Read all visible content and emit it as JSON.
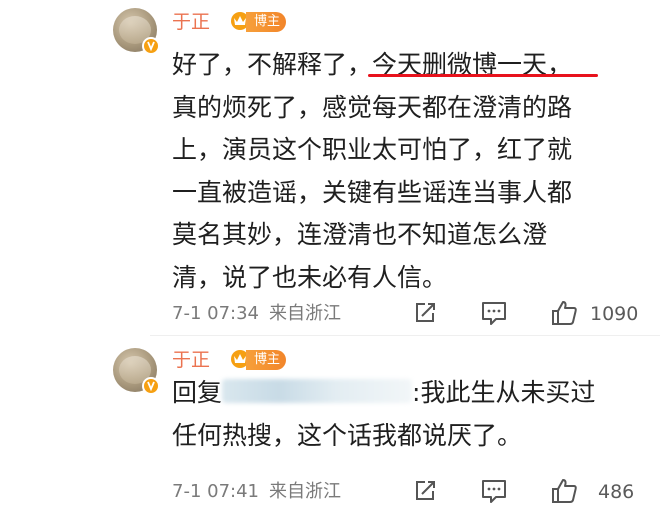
{
  "comments": [
    {
      "user": {
        "name": "于正",
        "tag": "博主"
      },
      "lines": [
        {
          "before": "好了，不解释了，",
          "underlined": "今天删微博一天，"
        },
        {
          "text": "真的烦死了，感觉每天都在澄清的路"
        },
        {
          "text": "上，演员这个职业太可怕了，红了就"
        },
        {
          "text": "一直被造谣，关键有些谣连当事人都"
        },
        {
          "text": "莫名其妙，连澄清也不知道怎么澄"
        },
        {
          "text": "清，说了也未必有人信。"
        }
      ],
      "time": "7-1 07:34",
      "source": "来自浙江",
      "likes": "1090"
    },
    {
      "user": {
        "name": "于正",
        "tag": "博主"
      },
      "reply_prefix": "回复",
      "reply_suffix": ":我此生从未买过",
      "line2": "任何热搜，这个话我都说厌了。",
      "time": "7-1 07:41",
      "source": "来自浙江",
      "likes": "486"
    }
  ],
  "icons": {
    "share": "share-icon",
    "comment": "comment-icon",
    "like": "like-icon",
    "vip": "crown-icon",
    "verified": "verified-icon"
  },
  "colors": {
    "username": "#eb7350",
    "underline": "#e8121c",
    "tag_bg": "#f2852a",
    "meta": "#7a7a7a"
  }
}
